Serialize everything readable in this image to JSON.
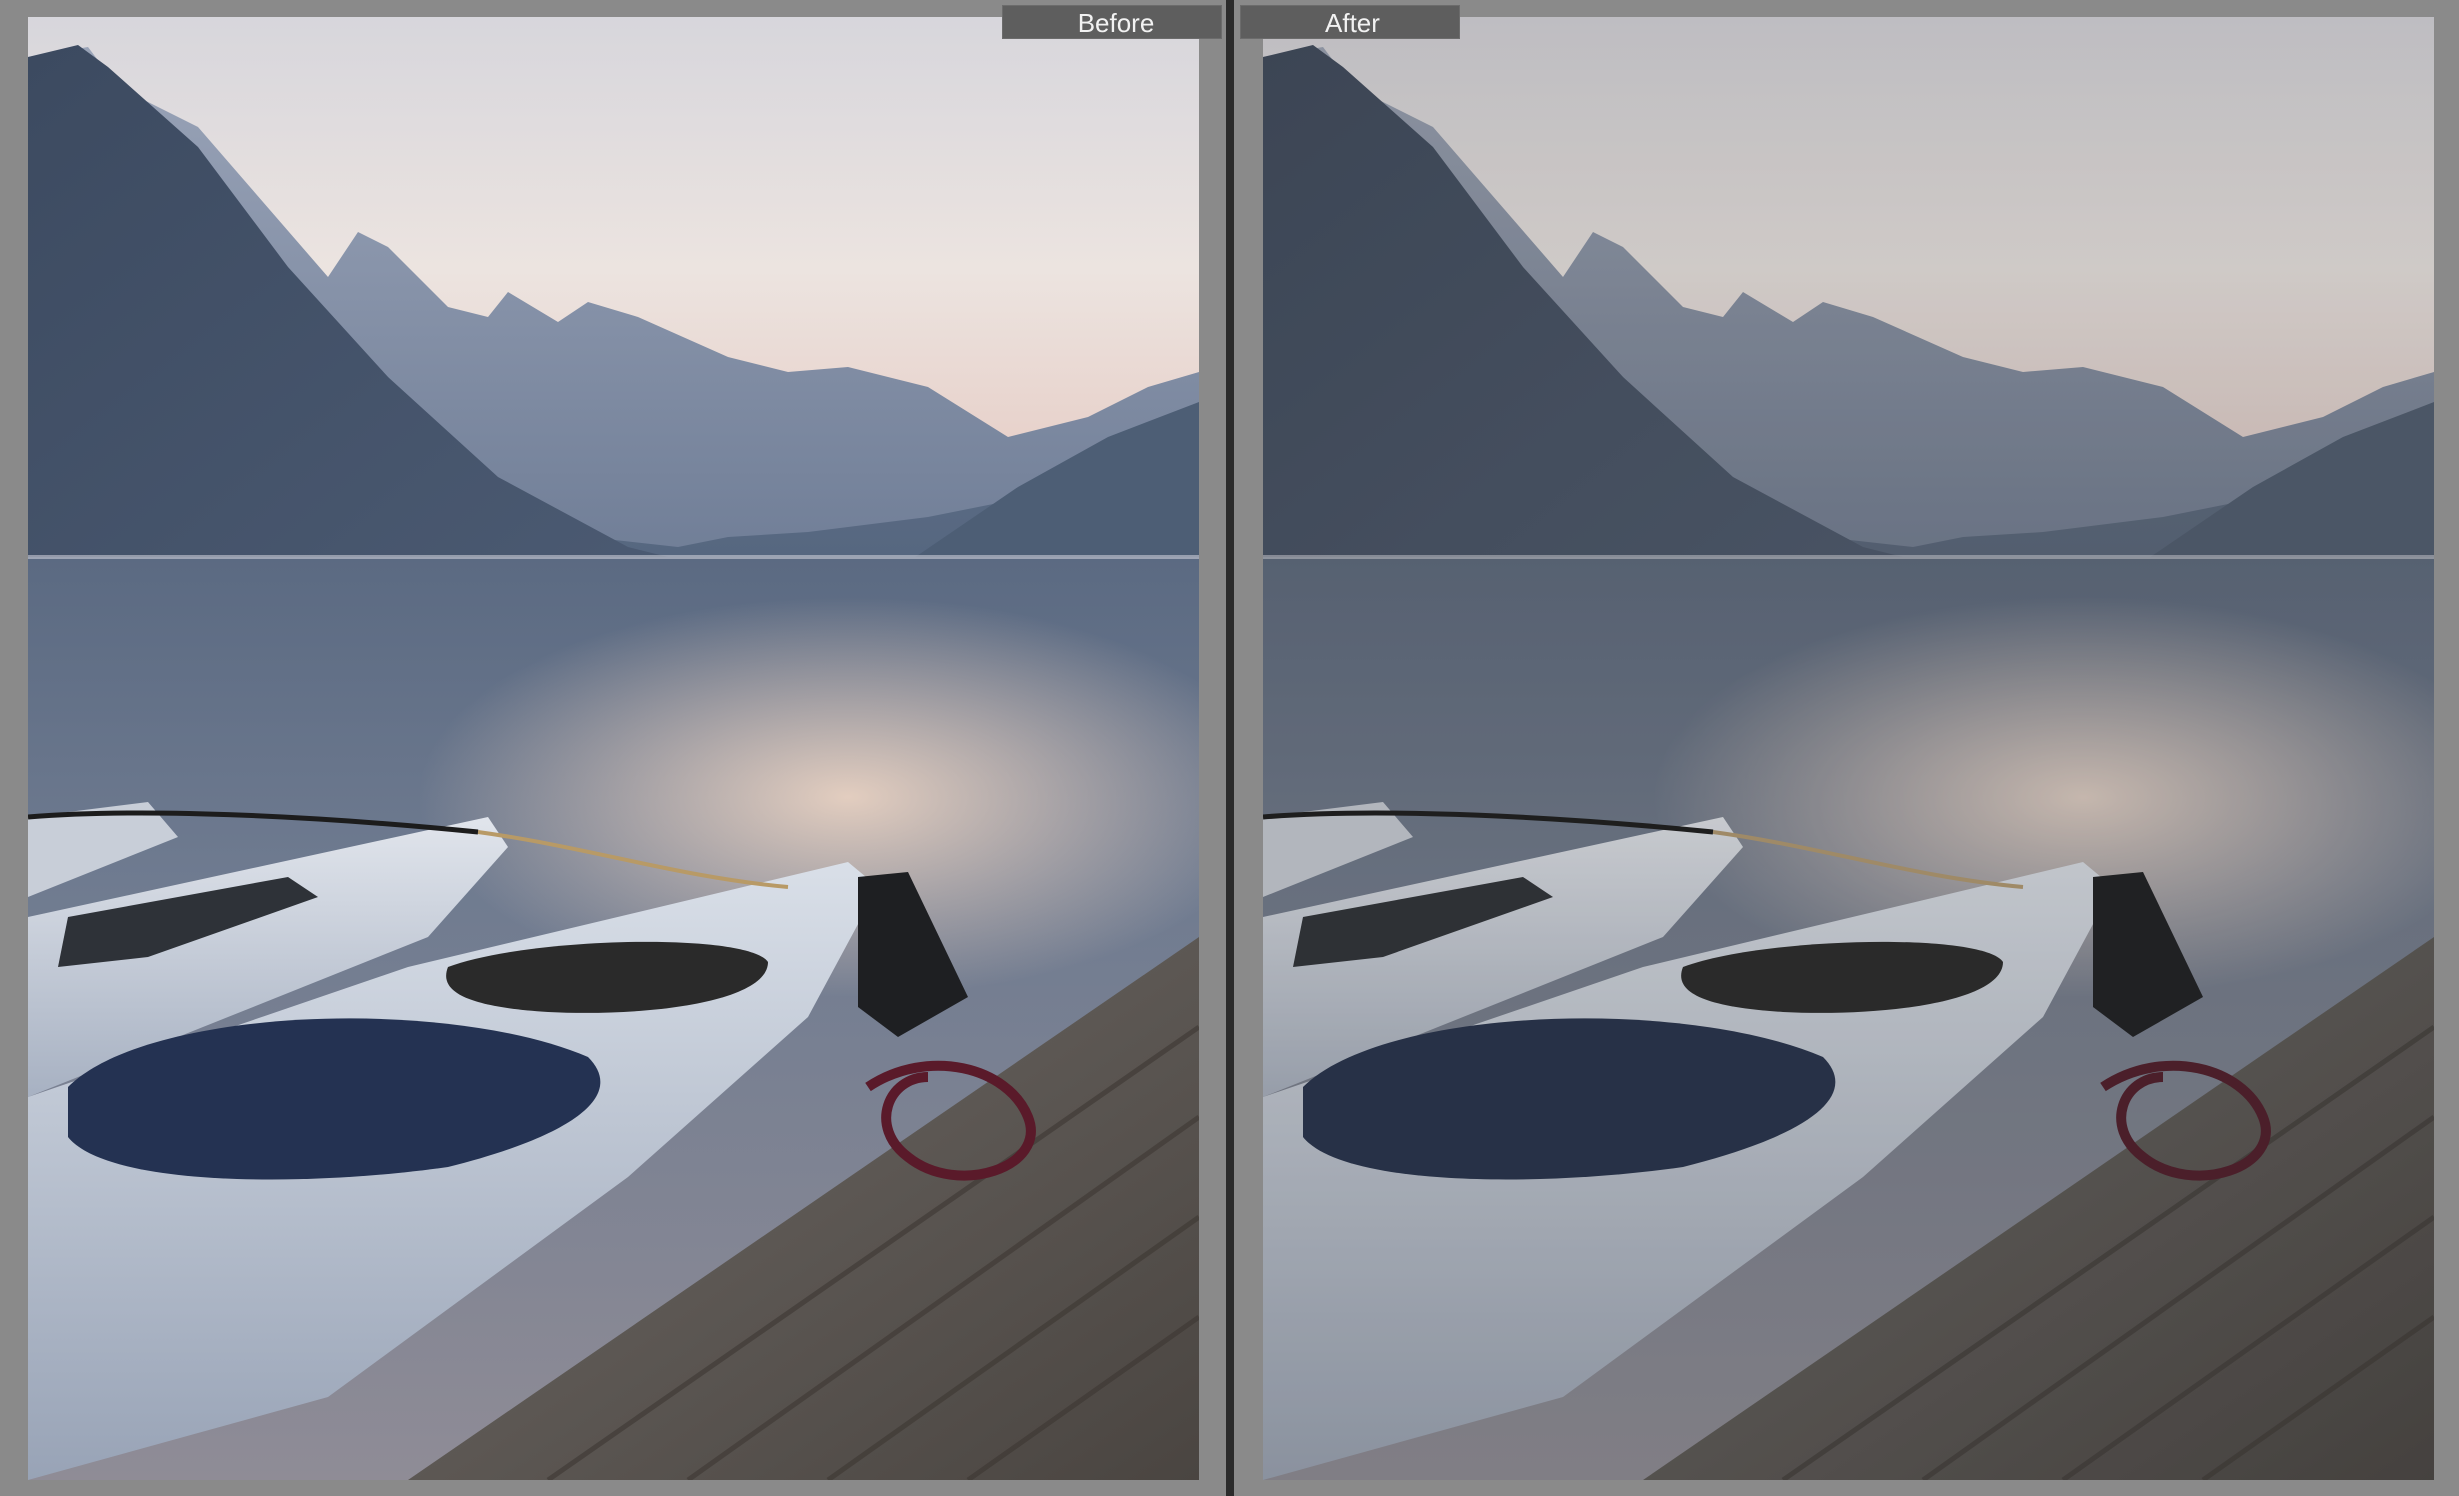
{
  "comparison": {
    "before_label": "Before",
    "after_label": "After"
  },
  "colors": {
    "frame_bg": "#8a8a8a",
    "divider": "#2b2b2b",
    "label_bg": "#5e5e5e",
    "label_text": "#f2f2f2"
  }
}
